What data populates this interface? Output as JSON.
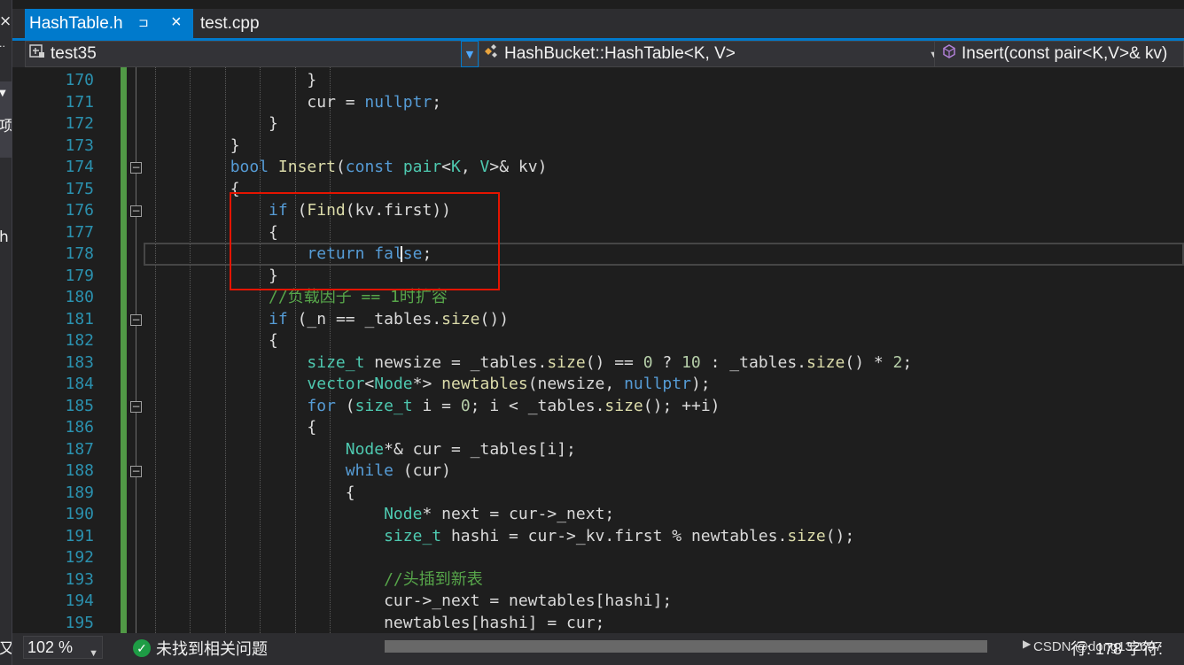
{
  "left_panel": {
    "glyphs": [
      "×",
      "··",
      "项",
      "h",
      "又"
    ]
  },
  "tabs": [
    {
      "label": "HashTable.h",
      "active": true,
      "pinned": true,
      "close": "×",
      "pin": "⊐"
    },
    {
      "label": "test.cpp",
      "active": false
    }
  ],
  "nav": {
    "project": "test35",
    "class_scope": "HashBucket::HashTable<K, V>",
    "member": "Insert(const pair<K,V>& kv)"
  },
  "editor": {
    "line_numbers": [
      "170",
      "171",
      "172",
      "173",
      "174",
      "175",
      "176",
      "177",
      "178",
      "179",
      "180",
      "181",
      "182",
      "183",
      "184",
      "185",
      "186",
      "187",
      "188",
      "189",
      "190",
      "191",
      "192",
      "193",
      "194",
      "195"
    ],
    "lines": [
      "                }",
      "                cur = nullptr;",
      "            }",
      "        }",
      "        bool Insert(const pair<K, V>& kv)",
      "        {",
      "            if (Find(kv.first))",
      "            {",
      "                return false;",
      "            }",
      "            //负载因子 == 1时扩容",
      "            if (_n == _tables.size())",
      "            {",
      "                size_t newsize = _tables.size() == 0 ? 10 : _tables.size() * 2;",
      "                vector<Node*> newtables(newsize, nullptr);",
      "                for (size_t i = 0; i < _tables.size(); ++i)",
      "                {",
      "                    Node*& cur = _tables[i];",
      "                    while (cur)",
      "                    {",
      "                        Node* next = cur->_next;",
      "                        size_t hashi = cur->_kv.first % newtables.size();",
      "",
      "                        //头插到新表",
      "                        cur->_next = newtables[hashi];",
      "                        newtables[hashi] = cur;"
    ],
    "fold_markers": [
      "174",
      "176",
      "181",
      "185",
      "188"
    ],
    "current_line": "178",
    "highlighted_lines": [
      "176",
      "179"
    ]
  },
  "status": {
    "zoom": "102 %",
    "issues": "未找到相关问题",
    "issues_icon": "check-circle-icon",
    "line_col": "行: 178    字符:",
    "watermark": "CSDN @dong132697"
  },
  "colors": {
    "accent": "#007acc",
    "highlight_box": "#e51400",
    "line_number": "#2b91af",
    "keyword": "#569cd6",
    "type": "#4ec9b0",
    "comment": "#57a64a"
  }
}
